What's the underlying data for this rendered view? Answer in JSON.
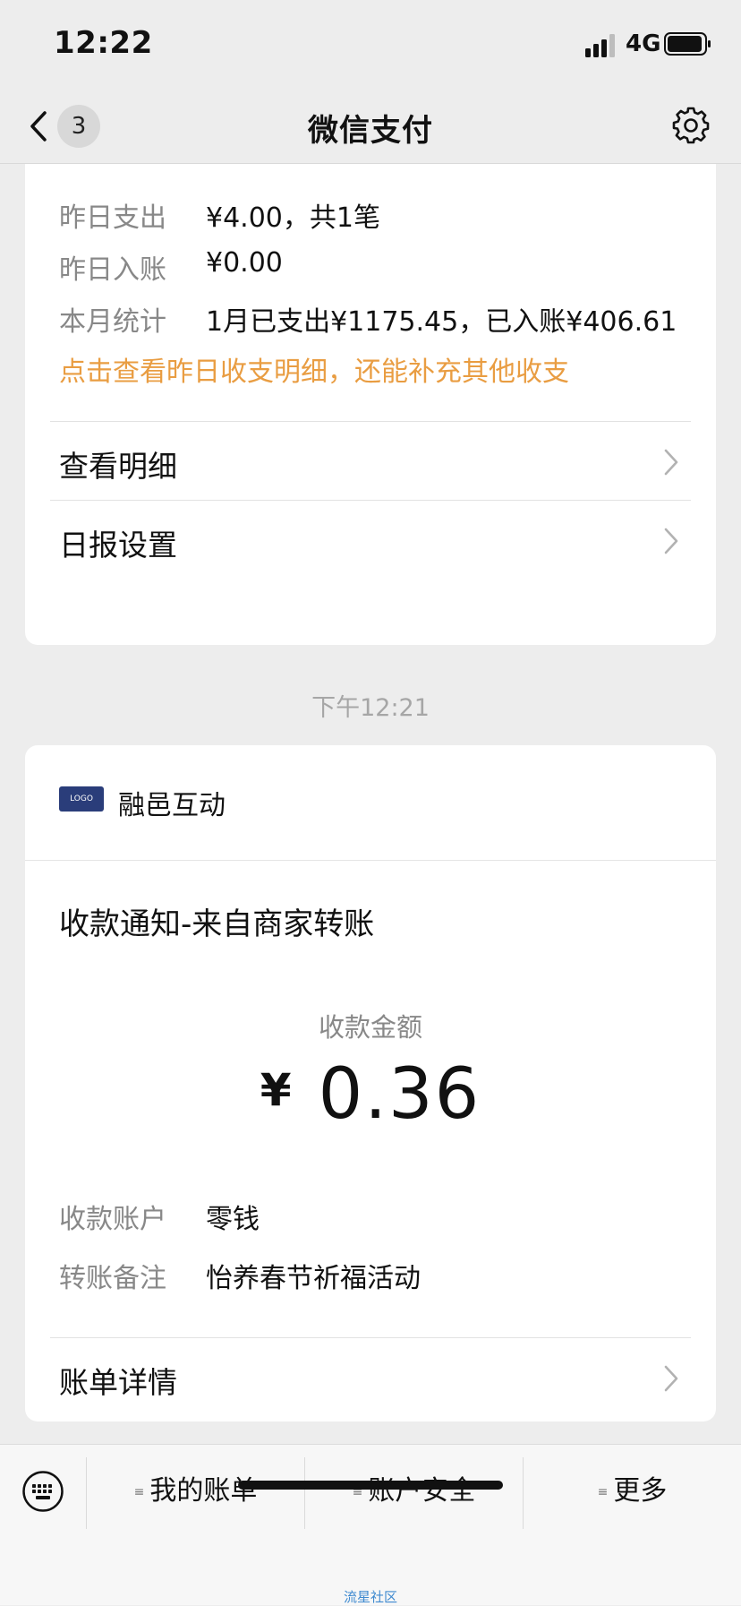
{
  "status_bar": {
    "time": "12:22",
    "network": "4G",
    "signal_icon": "signal-bars-icon",
    "battery_icon": "battery-icon"
  },
  "nav": {
    "back_icon": "chevron-left-icon",
    "badge_count": "3",
    "title": "微信支付",
    "settings_icon": "gear-icon"
  },
  "daily_report": {
    "rows": [
      {
        "label": "昨日支出",
        "value": "¥4.00，共1笔"
      },
      {
        "label": "昨日入账",
        "value": "¥0.00"
      },
      {
        "label": "本月统计",
        "value": "1月已支出¥1175.45，已入账¥406.61"
      }
    ],
    "hint": "点击查看昨日收支明细，还能补充其他收支",
    "links": [
      {
        "label": "查看明细"
      },
      {
        "label": "日报设置"
      }
    ]
  },
  "message_time": "下午12:21",
  "payment_notice": {
    "merchant_name": "融邑互动",
    "title": "收款通知-来自商家转账",
    "amount_label": "收款金额",
    "currency": "¥",
    "amount": "0.36",
    "rows": [
      {
        "label": "收款账户",
        "value": "零钱"
      },
      {
        "label": "转账备注",
        "value": "怡养春节祈福活动"
      }
    ],
    "link": {
      "label": "账单详情"
    }
  },
  "toolbar": {
    "keyboard_icon": "keyboard-icon",
    "items": [
      {
        "label": "我的账单"
      },
      {
        "label": "账户安全"
      },
      {
        "label": "更多"
      }
    ]
  },
  "watermark": "流星社区",
  "colors": {
    "background": "#ededed",
    "card": "#ffffff",
    "accent_orange": "#e99d42",
    "muted_text": "#888888"
  }
}
